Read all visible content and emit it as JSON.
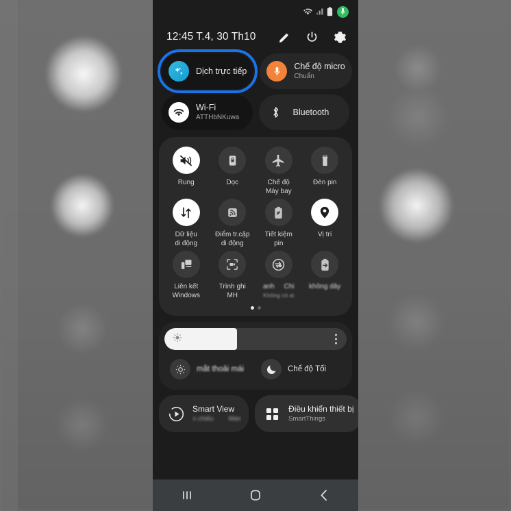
{
  "statusbar": {
    "icons": [
      "wifi-icon",
      "signal-icon",
      "battery-icon",
      "microphone-active-icon"
    ]
  },
  "header": {
    "clock": "12:45  T.4, 30 Th10",
    "actions": [
      {
        "name": "edit-icon",
        "label": "edit"
      },
      {
        "name": "power-icon",
        "label": "power"
      },
      {
        "name": "settings-gear-icon",
        "label": "settings"
      }
    ]
  },
  "pills": {
    "translate": {
      "title": "Dịch trực tiếp",
      "sub": "",
      "icon": "live-translate-icon",
      "highlighted": true
    },
    "mic_mode": {
      "title": "Chế độ micro",
      "sub": "Chuẩn",
      "icon": "microphone-icon"
    },
    "wifi": {
      "title": "Wi-Fi",
      "sub": "ATTHbNKuwa",
      "icon": "wifi-icon"
    },
    "bluetooth": {
      "title": "Bluetooth",
      "sub": "",
      "icon": "bluetooth-icon"
    }
  },
  "tiles": [
    {
      "label": "Rung",
      "sub": "",
      "icon": "vibrate-icon",
      "active": true
    },
    {
      "label": "Dọc",
      "sub": "",
      "icon": "rotation-lock-icon",
      "active": false
    },
    {
      "label": "Chế độ\nMáy bay",
      "line1": "Chế độ",
      "line2": "Máy bay",
      "icon": "airplane-icon",
      "active": false
    },
    {
      "label": "Đèn pin",
      "sub": "",
      "icon": "flashlight-icon",
      "active": false
    },
    {
      "label": "Dữ liệu\ndi động",
      "line1": "Dữ liệu",
      "line2": "di động",
      "icon": "mobile-data-icon",
      "active": true
    },
    {
      "label": "Điểm tr.cập\ndi động",
      "line1": "Điểm tr.cập",
      "line2": "di động",
      "icon": "hotspot-icon",
      "active": false
    },
    {
      "label": "Tiết kiệm\npin",
      "line1": "Tiết kiệm",
      "line2": "pin",
      "icon": "battery-saver-icon",
      "active": false
    },
    {
      "label": "Vị trí",
      "sub": "",
      "icon": "location-pin-icon",
      "active": true
    },
    {
      "label": "Liên kết\nWindows",
      "line1": "Liên kết",
      "line2": "Windows",
      "icon": "link-to-windows-icon",
      "active": false
    },
    {
      "label": "Trình ghi\nMH",
      "line1": "Trình ghi",
      "line2": "MH",
      "icon": "screen-recorder-icon",
      "active": false
    },
    {
      "label": "anh       Chi",
      "line1": "anh",
      "line1b": "Chi",
      "line2": "Không có ai",
      "icon": "quick-share-icon",
      "active": false
    },
    {
      "label": "không dây",
      "line1": "không dây",
      "line2": "",
      "icon": "wireless-power-share-icon",
      "active": false
    }
  ],
  "page_dots": {
    "count": 2,
    "active_index": 0
  },
  "brightness": {
    "value_percent": 40,
    "icon": "brightness-icon",
    "menu_icon": "more-options-icon"
  },
  "display_modes": [
    {
      "label": "mắt thoải mái",
      "icon": "eye-comfort-icon",
      "blurred": true
    },
    {
      "label": "Chế độ Tối",
      "icon": "dark-mode-moon-icon",
      "blurred": false
    }
  ],
  "bottom_cards": [
    {
      "title": "Smart View",
      "sub_a": "n chiếu",
      "sub_b": "Màn",
      "icon": "smart-view-icon",
      "blurred_sub": true
    },
    {
      "title": "Điều khiển thiết bị",
      "sub_a": "SmartThings",
      "sub_b": "",
      "icon": "device-control-grid-icon",
      "blurred_sub": false
    }
  ],
  "navbar": [
    {
      "name": "recents-button",
      "glyph": "|||"
    },
    {
      "name": "home-button",
      "glyph": "O"
    },
    {
      "name": "back-button",
      "glyph": "<"
    }
  ],
  "colors": {
    "highlight": "#1a73e8",
    "mic_accent": "#f2833a",
    "translate_accent": "#1fa8d8",
    "mic_badge_green": "#2dbe60",
    "panel": "#2a2a2a",
    "phone_bg": "#1c1c1c"
  }
}
